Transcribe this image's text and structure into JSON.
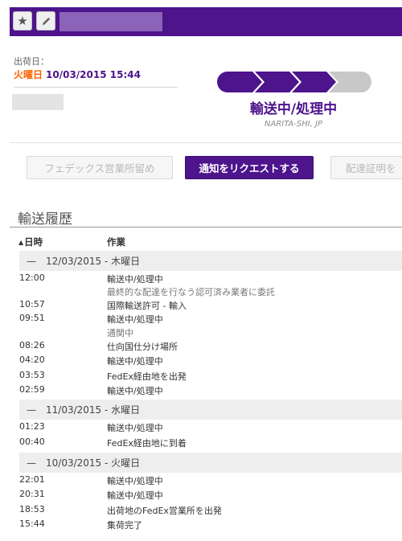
{
  "shipment": {
    "ship_date_label": "出荷日：",
    "ship_day": "火曜日",
    "ship_datetime": "10/03/2015 15:44"
  },
  "status": {
    "title": "輸送中/処理中",
    "location": "NARITA-SHI, JP",
    "progress_steps_complete": 3,
    "progress_steps_total": 4
  },
  "buttons": {
    "hold": "フェデックス営業所留め",
    "notify": "通知をリクエストする",
    "proof": "配達証明を"
  },
  "history": {
    "title": "輸送履歴",
    "col_datetime": "日時",
    "col_activity": "作業",
    "days": [
      {
        "label": "—　12/03/2015 - 木曜日",
        "events": [
          {
            "time": "12:00",
            "activity": "輸送中/処理中",
            "detail": "最終的な配達を行なう認可済み業者に委託"
          },
          {
            "time": "10:57",
            "activity": "国際輸送許可 - 輸入"
          },
          {
            "time": "09:51",
            "activity": "輸送中/処理中",
            "detail": "通関中"
          },
          {
            "time": "08:26",
            "activity": "仕向国仕分け場所"
          },
          {
            "time": "04:20",
            "activity": "輸送中/処理中"
          },
          {
            "time": "03:53",
            "activity": "FedEx経由地を出発"
          },
          {
            "time": "02:59",
            "activity": "輸送中/処理中"
          }
        ]
      },
      {
        "label": "—　11/03/2015 - 水曜日",
        "events": [
          {
            "time": "01:23",
            "activity": "輸送中/処理中"
          },
          {
            "time": "00:40",
            "activity": "FedEx経由地に到着"
          }
        ]
      },
      {
        "label": "—　10/03/2015 - 火曜日",
        "events": [
          {
            "time": "22:01",
            "activity": "輸送中/処理中"
          },
          {
            "time": "20:31",
            "activity": "輸送中/処理中"
          },
          {
            "time": "18:53",
            "activity": "出荷地のFedEx営業所を出発"
          },
          {
            "time": "15:44",
            "activity": "集荷完了"
          }
        ]
      }
    ]
  },
  "colors": {
    "brand_purple": "#4d148c",
    "accent_orange": "#ff6200",
    "progress_inactive": "#c8c8c8"
  }
}
